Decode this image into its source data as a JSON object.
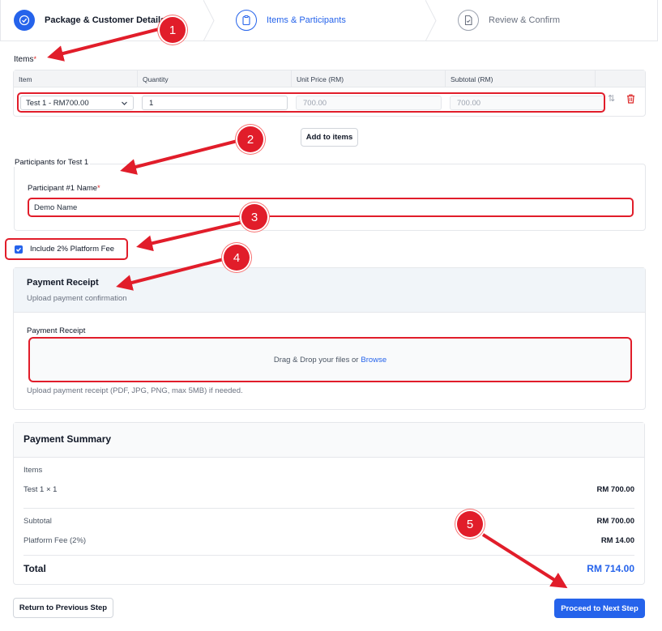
{
  "stepper": {
    "steps": [
      {
        "label": "Package & Customer Details",
        "state": "completed"
      },
      {
        "label": "Items & Participants",
        "state": "active"
      },
      {
        "label": "Review & Confirm",
        "state": "pending"
      }
    ]
  },
  "items": {
    "label": "Items",
    "required_mark": "*",
    "columns": [
      "Item",
      "Quantity",
      "Unit Price (RM)",
      "Subtotal (RM)"
    ],
    "row": {
      "item": "Test 1 - RM700.00",
      "quantity": "1",
      "unit_price": "700.00",
      "subtotal": "700.00"
    },
    "add_button": "Add to items"
  },
  "participants": {
    "title": "Participants for Test 1",
    "name_label": "Participant #1 Name",
    "required_mark": "*",
    "name_value": "Demo Name"
  },
  "platform_fee": {
    "label": "Include 2% Platform Fee",
    "checked": true
  },
  "receipt": {
    "title": "Payment Receipt",
    "subtitle": "Upload payment confirmation",
    "field_label": "Payment Receipt",
    "dropzone_text": "Drag & Drop your files or",
    "browse": "Browse",
    "help": "Upload payment receipt (PDF, JPG, PNG, max 5MB) if needed."
  },
  "summary": {
    "title": "Payment Summary",
    "items_label": "Items",
    "item_line": "Test 1 × 1",
    "item_amount": "RM 700.00",
    "subtotal_label": "Subtotal",
    "subtotal_value": "RM 700.00",
    "fee_label": "Platform Fee (2%)",
    "fee_value": "RM 14.00",
    "total_label": "Total",
    "total_value": "RM 714.00"
  },
  "actions": {
    "back": "Return to Previous Step",
    "next": "Proceed to Next Step"
  },
  "annotations": [
    "1",
    "2",
    "3",
    "4",
    "5"
  ],
  "colors": {
    "accent": "#2563eb",
    "annotation": "#e11d2a"
  }
}
